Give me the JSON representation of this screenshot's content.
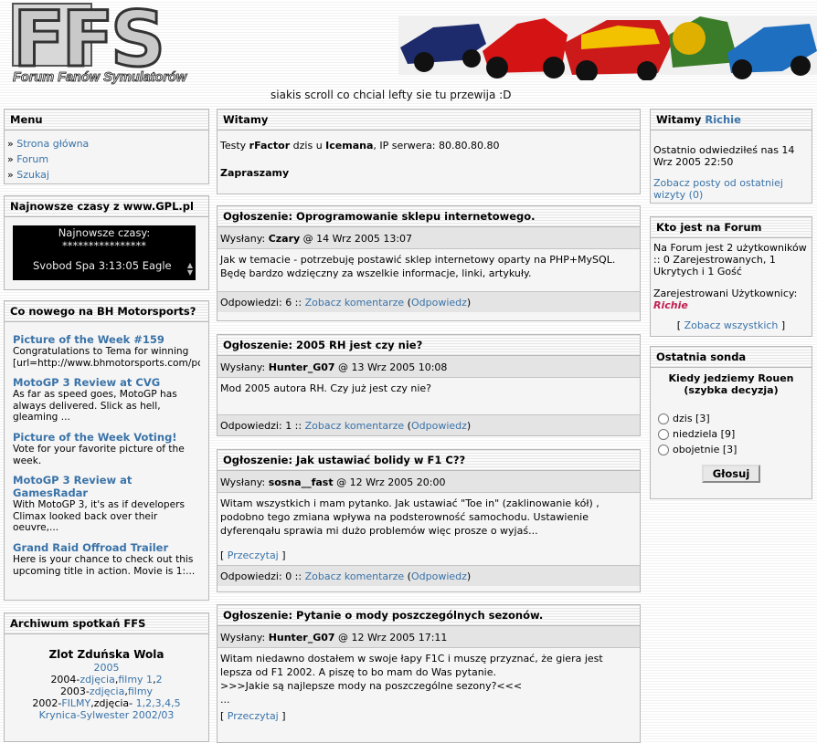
{
  "header": {
    "logo_title": "FFS",
    "logo_subtitle": "Forum Fanów Symulatorów",
    "scroll_text": "siakis scroll co chcial lefty sie tu przewija :D"
  },
  "menu": {
    "title": "Menu",
    "items": [
      "Strona główna",
      "Forum",
      "Szukaj"
    ]
  },
  "gpl": {
    "title": "Najnowsze czasy z www.GPL.pl",
    "line1": "Najnowsze czasy:",
    "line2": "****************",
    "line3": "Svobod Spa 3:13:05 Eagle"
  },
  "bh": {
    "title": "Co nowego na BH Motorsports?",
    "items": [
      {
        "title": "Picture of the Week #159",
        "desc": "Congratulations to Tema for winning [url=http://www.bhmotorsports.com/po"
      },
      {
        "title": "MotoGP 3 Review at CVG",
        "desc": "As far as speed goes, MotoGP has always delivered. Slick as hell, gleaming ..."
      },
      {
        "title": "Picture of the Week Voting!",
        "desc": "Vote for your favorite picture of the week."
      },
      {
        "title": "MotoGP 3 Review at GamesRadar",
        "desc": "With MotoGP 3, it's as if developers Climax looked back over their oeuvre,..."
      },
      {
        "title": "Grand Raid Offroad Trailer",
        "desc": "Here is your chance to check out this upcoming title in action. Movie is 1:..."
      }
    ]
  },
  "archive": {
    "title": "Archiwum spotkań FFS",
    "heading": "Zlot Zduńska Wola",
    "year1": "2005",
    "l2_pre": "2004-",
    "l2_a": "zdjęcia",
    "l2_b": ",",
    "l2_c": "filmy 1",
    "l2_d": ",",
    "l2_e": "2",
    "l3_pre": "2003-",
    "l3_a": "zdjęcia",
    "l3_b": ",",
    "l3_c": "filmy",
    "l4_pre": "2002-",
    "l4_a": "FILMY",
    "l4_b": ",zdjęcia- ",
    "l4_c": "1,2,3,4,5",
    "l5": "Krynica-Sylwester 2002/03"
  },
  "welcome": {
    "title": "Witamy",
    "t1": "Testy ",
    "t2": "rFactor",
    "t3": " dzis u ",
    "t4": "Icemana",
    "t5": ", IP serwera: 80.80.80.80",
    "bottom": "Zapraszamy"
  },
  "posts": [
    {
      "title": "Ogłoszenie: Oprogramowanie sklepu internetowego.",
      "by_label": "Wysłany: ",
      "author": "Czary",
      "date": " @ 14 Wrz 2005 13:07",
      "body": "Jak w temacie - potrzebuję postawić sklep internetowy oparty na PHP+MySQL. Będę bardzo wdzięczny za wszelkie informacje, linki, artykuły.",
      "replies": "Odpowiedzi: 6 :: ",
      "view": "Zobacz komentarze",
      "reply": "Odpowiedz"
    },
    {
      "title": "Ogłoszenie: 2005 RH jest czy nie?",
      "by_label": "Wysłany: ",
      "author": "Hunter_G07",
      "date": " @ 13 Wrz 2005 10:08",
      "body": "Mod 2005 autora RH. Czy już jest czy nie?",
      "replies": "Odpowiedzi: 1 :: ",
      "view": "Zobacz komentarze",
      "reply": "Odpowiedz"
    },
    {
      "title": "Ogłoszenie: Jak ustawiać bolidy w F1 C??",
      "by_label": "Wysłany: ",
      "author": "sosna__fast",
      "date": " @ 12 Wrz 2005 20:00",
      "body": "Witam wszystkich i mam pytanko. Jak ustawiać \"Toe in\" (zaklinowanie kół) , podobno tego zmiana wpływa na podsterowność samochodu. Ustawienie dyferenqału sprawia mi dużo problemów więc prosze o wyjaś...",
      "read_more": "Przeczytaj",
      "replies": "Odpowiedzi: 0 :: ",
      "view": "Zobacz komentarze",
      "reply": "Odpowiedz"
    },
    {
      "title": "Ogłoszenie: Pytanie o mody poszczególnych sezonów.",
      "by_label": "Wysłany: ",
      "author": "Hunter_G07",
      "date": " @ 12 Wrz 2005 17:11",
      "body1": "Witam niedawno dostałem w swoje łapy F1C i muszę przyznać, że giera jest lepsza od F1 2002. A piszę to bo mam do Was pytanie.",
      "body2": ">>>Jakie są najlepsze mody na poszczególne sezony?<<<",
      "body3": "...",
      "read_more": "Przeczytaj"
    }
  ],
  "user": {
    "title_pre": "Witamy ",
    "title_name": "Richie",
    "last_visit": "Ostatnio odwiedziłeś nas 14 Wrz 2005 22:50",
    "new_posts": "Zobacz posty od ostatniej wizyty (0)"
  },
  "online": {
    "title": "Kto jest na Forum",
    "l1": "Na Forum jest 2 użytkowników :: 0 Zarejestrowanych, 1 Ukrytych i 1 Gość",
    "reg_label": "Zarejestrowani Użytkownicy:",
    "reg_name": "Richie",
    "see_all": "Zobacz wszystkich"
  },
  "poll": {
    "title": "Ostatnia sonda",
    "question": "Kiedy jedziemy Rouen (szybka decyzja)",
    "options": [
      "dzis [3]",
      "niedziela [9]",
      "obojetnie [3]"
    ],
    "vote": "Głosuj"
  }
}
